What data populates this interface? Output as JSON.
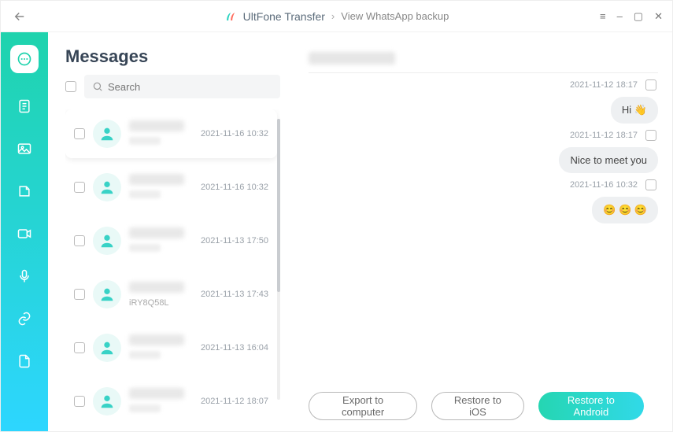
{
  "title": {
    "app_name": "UltFone Transfer",
    "breadcrumb": "View WhatsApp backup"
  },
  "search": {
    "placeholder": "Search"
  },
  "messages_title": "Messages",
  "conversations": [
    {
      "time": "2021-11-16 10:32",
      "snippet": "",
      "selected": true
    },
    {
      "time": "2021-11-16 10:32",
      "snippet": "",
      "selected": false
    },
    {
      "time": "2021-11-13 17:50",
      "snippet": "",
      "selected": false
    },
    {
      "time": "2021-11-13 17:43",
      "snippet": "iRY8Q58L",
      "selected": false
    },
    {
      "time": "2021-11-13 16:04",
      "snippet": "",
      "selected": false
    },
    {
      "time": "2021-11-12 18:07",
      "snippet": "",
      "selected": false
    }
  ],
  "chat": [
    {
      "time": "2021-11-12 18:17",
      "text": "Hi 👋"
    },
    {
      "time": "2021-11-12 18:17",
      "text": "Nice to meet you"
    },
    {
      "time": "2021-11-16 10:32",
      "text": "😊 😊 😊"
    }
  ],
  "footer": {
    "export": "Export to computer",
    "restore_ios": "Restore to iOS",
    "restore_android": "Restore to Android"
  }
}
